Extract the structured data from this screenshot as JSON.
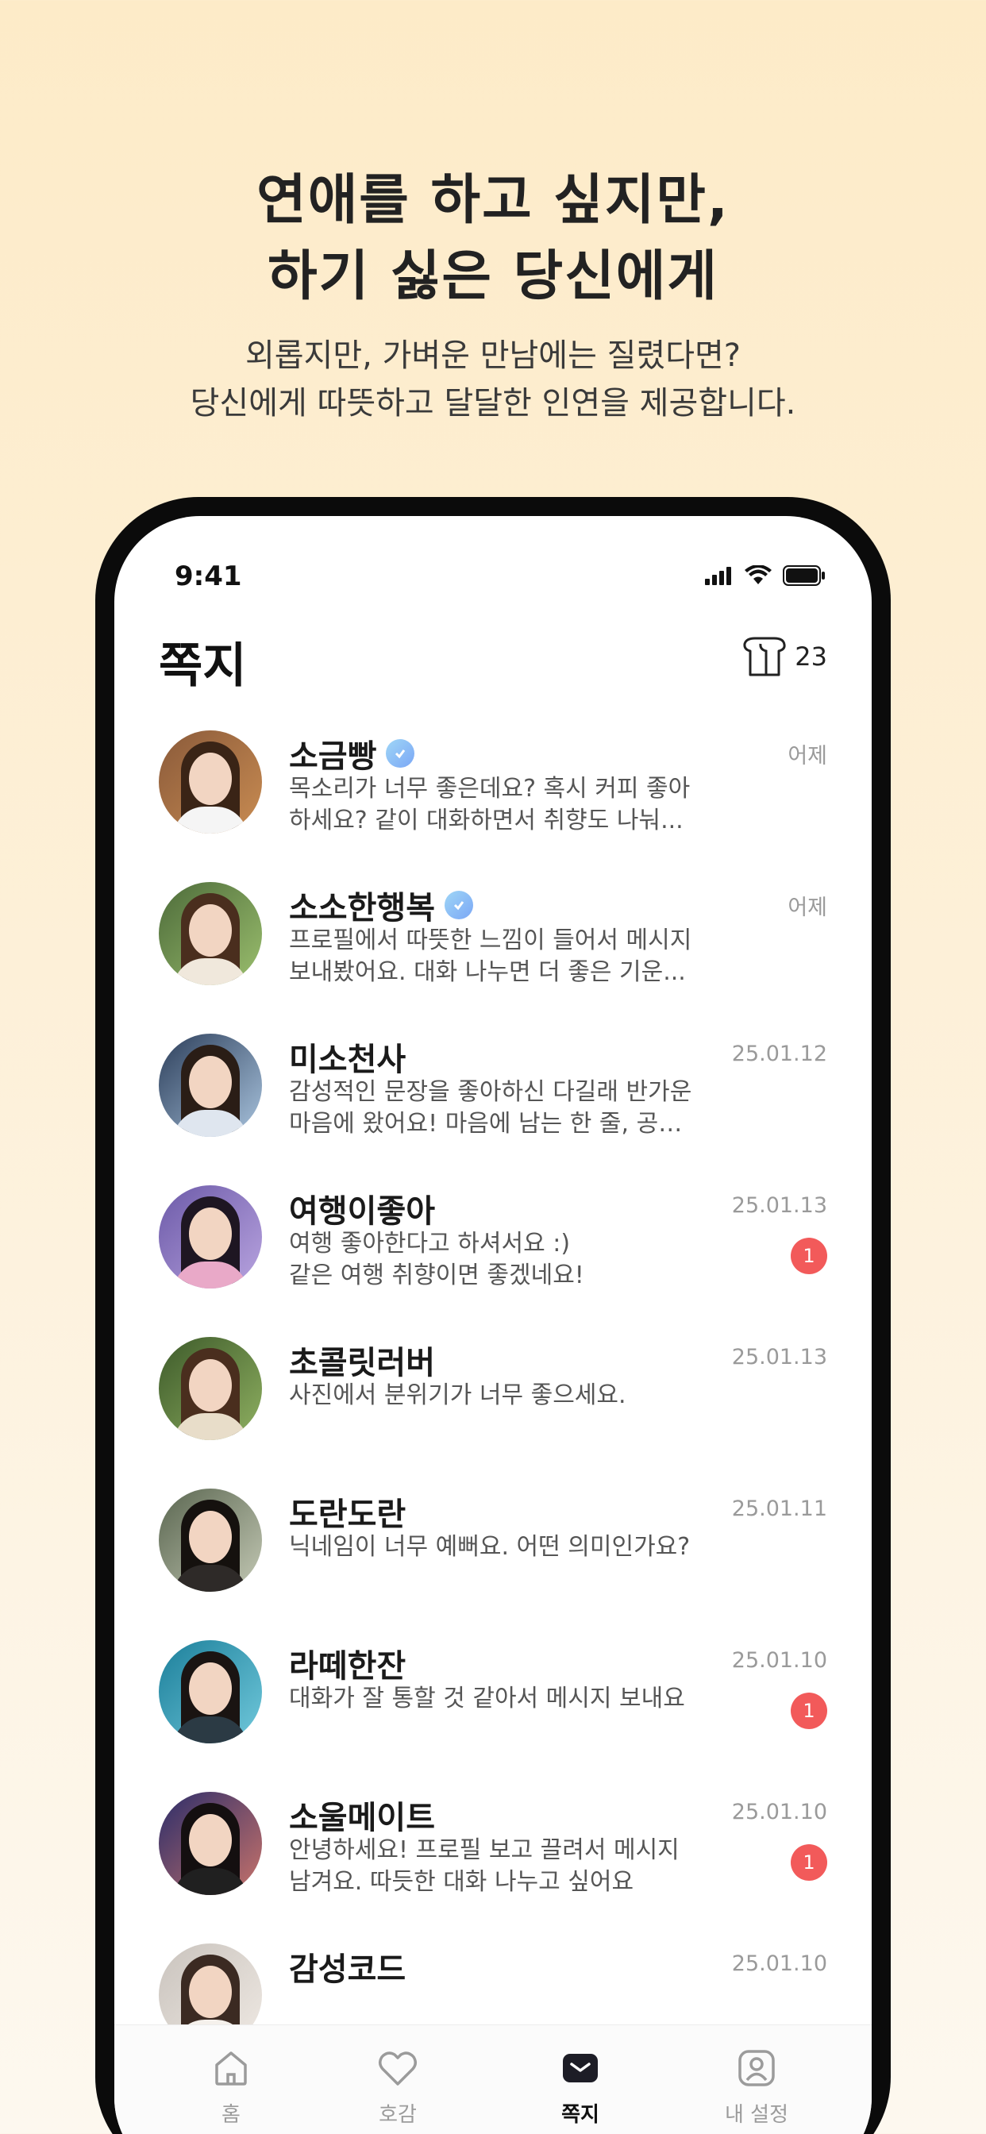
{
  "promo": {
    "headline_line1": "연애를 하고 싶지만,",
    "headline_line2": "하기 싫은 당신에게",
    "sub_line1": "외롭지만, 가벼운 만남에는 질렸다면?",
    "sub_line2": "당신에게 따뜻하고 달달한 인연을 제공합니다."
  },
  "status_bar": {
    "time": "9:41",
    "icons": [
      "cellular-icon",
      "wifi-icon",
      "battery-icon"
    ]
  },
  "header": {
    "title": "쪽지",
    "credit_icon": "bread-icon",
    "credit_count": "23"
  },
  "messages": [
    {
      "name": "소금빵",
      "verified": true,
      "line1": "목소리가 너무 좋은데요? 혹시 커피 좋아",
      "line2": "하세요? 같이 대화하면서 취향도 나눠...",
      "date": "어제",
      "badge": ""
    },
    {
      "name": "소소한행복",
      "verified": true,
      "line1": "프로필에서 따뜻한 느낌이 들어서 메시지",
      "line2": "보내봤어요. 대화 나누면 더 좋은 기운...",
      "date": "어제",
      "badge": ""
    },
    {
      "name": "미소천사",
      "verified": false,
      "line1": "감성적인 문장을 좋아하신 다길래 반가운",
      "line2": "마음에 왔어요! 마음에 남는 한 줄, 공유...",
      "date": "25.01.12",
      "badge": ""
    },
    {
      "name": "여행이좋아",
      "verified": false,
      "line1": "여행 좋아한다고 하셔서요 :)",
      "line2": "같은 여행 취향이면 좋겠네요!",
      "date": "25.01.13",
      "badge": "1"
    },
    {
      "name": "초콜릿러버",
      "verified": false,
      "line1": "사진에서 분위기가 너무 좋으세요.",
      "line2": "",
      "date": "25.01.13",
      "badge": ""
    },
    {
      "name": "도란도란",
      "verified": false,
      "line1": "닉네임이 너무 예뻐요. 어떤 의미인가요?",
      "line2": "",
      "date": "25.01.11",
      "badge": ""
    },
    {
      "name": "라떼한잔",
      "verified": false,
      "line1": "대화가 잘 통할 것 같아서 메시지 보내요",
      "line2": "",
      "date": "25.01.10",
      "badge": "1"
    },
    {
      "name": "소울메이트",
      "verified": false,
      "line1": "안녕하세요! 프로필 보고 끌려서 메시지",
      "line2": "남겨요. 따듯한 대화 나누고 싶어요",
      "date": "25.01.10",
      "badge": "1"
    },
    {
      "name": "감성코드",
      "verified": false,
      "line1": "",
      "line2": "",
      "date": "25.01.10",
      "badge": ""
    }
  ],
  "tabs": [
    {
      "label": "홈",
      "icon": "home-icon",
      "active": false
    },
    {
      "label": "호감",
      "icon": "heart-icon",
      "active": false
    },
    {
      "label": "쪽지",
      "icon": "mail-icon",
      "active": true
    },
    {
      "label": "내 설정",
      "icon": "profile-icon",
      "active": false
    }
  ],
  "colors": {
    "badge": "#f25a5a",
    "background_top": "#fdebc8",
    "accent_text": "#111111"
  }
}
